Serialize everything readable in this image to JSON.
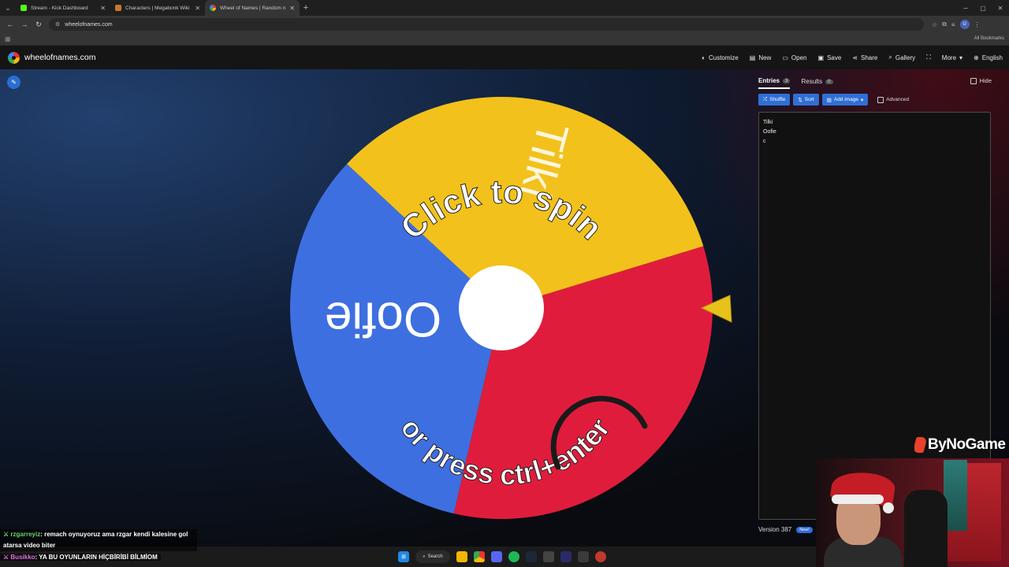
{
  "browser": {
    "tabs": [
      {
        "label": "Stream - Kick Dashboard",
        "color": "#53fc18",
        "active": false
      },
      {
        "label": "Characters | Megabonk Wiki | F",
        "color": "#c8772e",
        "active": false
      },
      {
        "label": "Wheel of Names | Random nam",
        "color": "#4285f4",
        "active": true
      }
    ],
    "url": "wheelofnames.com",
    "all_bookmarks": "All Bookmarks",
    "profile_initial": "U"
  },
  "site": {
    "logo_text": "wheelofnames.com",
    "menu": [
      {
        "label": "Customize",
        "icon": "palette-icon"
      },
      {
        "label": "New",
        "icon": "file-icon"
      },
      {
        "label": "Open",
        "icon": "folder-icon"
      },
      {
        "label": "Save",
        "icon": "save-icon"
      },
      {
        "label": "Share",
        "icon": "share-icon"
      },
      {
        "label": "Gallery",
        "icon": "search-icon"
      },
      {
        "label": "",
        "icon": "fullscreen-icon"
      },
      {
        "label": "More",
        "icon": "chevron-down-icon"
      },
      {
        "label": "English",
        "icon": "globe-icon"
      }
    ]
  },
  "wheel": {
    "slices": [
      {
        "label": "Tilki",
        "color": "#3e6fe0"
      },
      {
        "label": "Oofie",
        "color": "#e01c3c"
      },
      {
        "label": "",
        "color": "#f2c11b"
      }
    ],
    "overlay_top": "Click to spin",
    "overlay_bottom": "or press ctrl+enter"
  },
  "panel": {
    "tabs": [
      {
        "label": "Entries",
        "count": "3",
        "active": true
      },
      {
        "label": "Results",
        "count": "0",
        "active": false
      }
    ],
    "hide_label": "Hide",
    "tools": {
      "shuffle": "Shuffle",
      "sort": "Sort",
      "add_image": "Add image",
      "advanced": "Advanced"
    },
    "entries": [
      "Tilki",
      "Oofie",
      "c"
    ],
    "version": "Version 387",
    "new_badge": "New!"
  },
  "stream": {
    "brand": "ByNoGame",
    "chat": [
      {
        "user": "rzgarreyiz",
        "message": ": remach oynuyoruz ama rzgar kendi kalesine gol atarsa video biter"
      },
      {
        "user": "Busikko",
        "message": ": YA BU OYUNLARIN HİÇBİRİBİ BİLMİOM"
      }
    ]
  },
  "taskbar": {
    "search_label": "Search"
  }
}
